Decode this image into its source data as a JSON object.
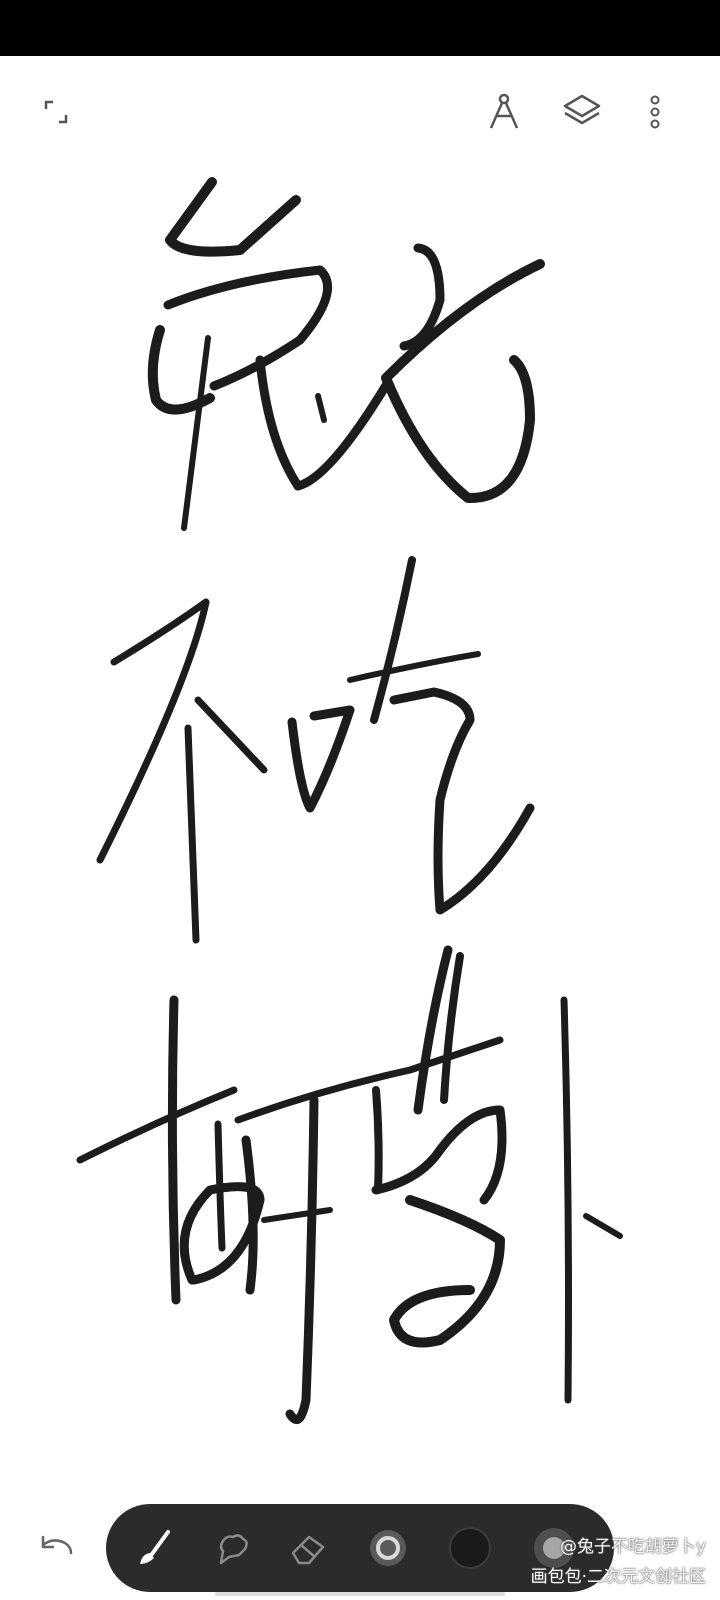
{
  "app": {
    "top_actions": [
      "fullscreen-icon",
      "ruler-icon",
      "layers-icon",
      "more-vertical-icon"
    ],
    "bottom_tools": [
      "undo-icon",
      "brush-icon",
      "smudge-icon",
      "eraser-icon",
      "brush-size-icon",
      "color-swatch"
    ]
  },
  "canvas": {
    "artwork": "handwritten calligraphy strokes",
    "stroke_color": "#1c1c1c",
    "background": "#ffffff"
  },
  "toolbar": {
    "active_tool": "brush",
    "selected_color": "#1a1a1a",
    "background": "#2b2b2b"
  },
  "watermark": {
    "author": "@兔子不吃胡萝卜y",
    "platform": "画包包·二次元文创社区"
  }
}
